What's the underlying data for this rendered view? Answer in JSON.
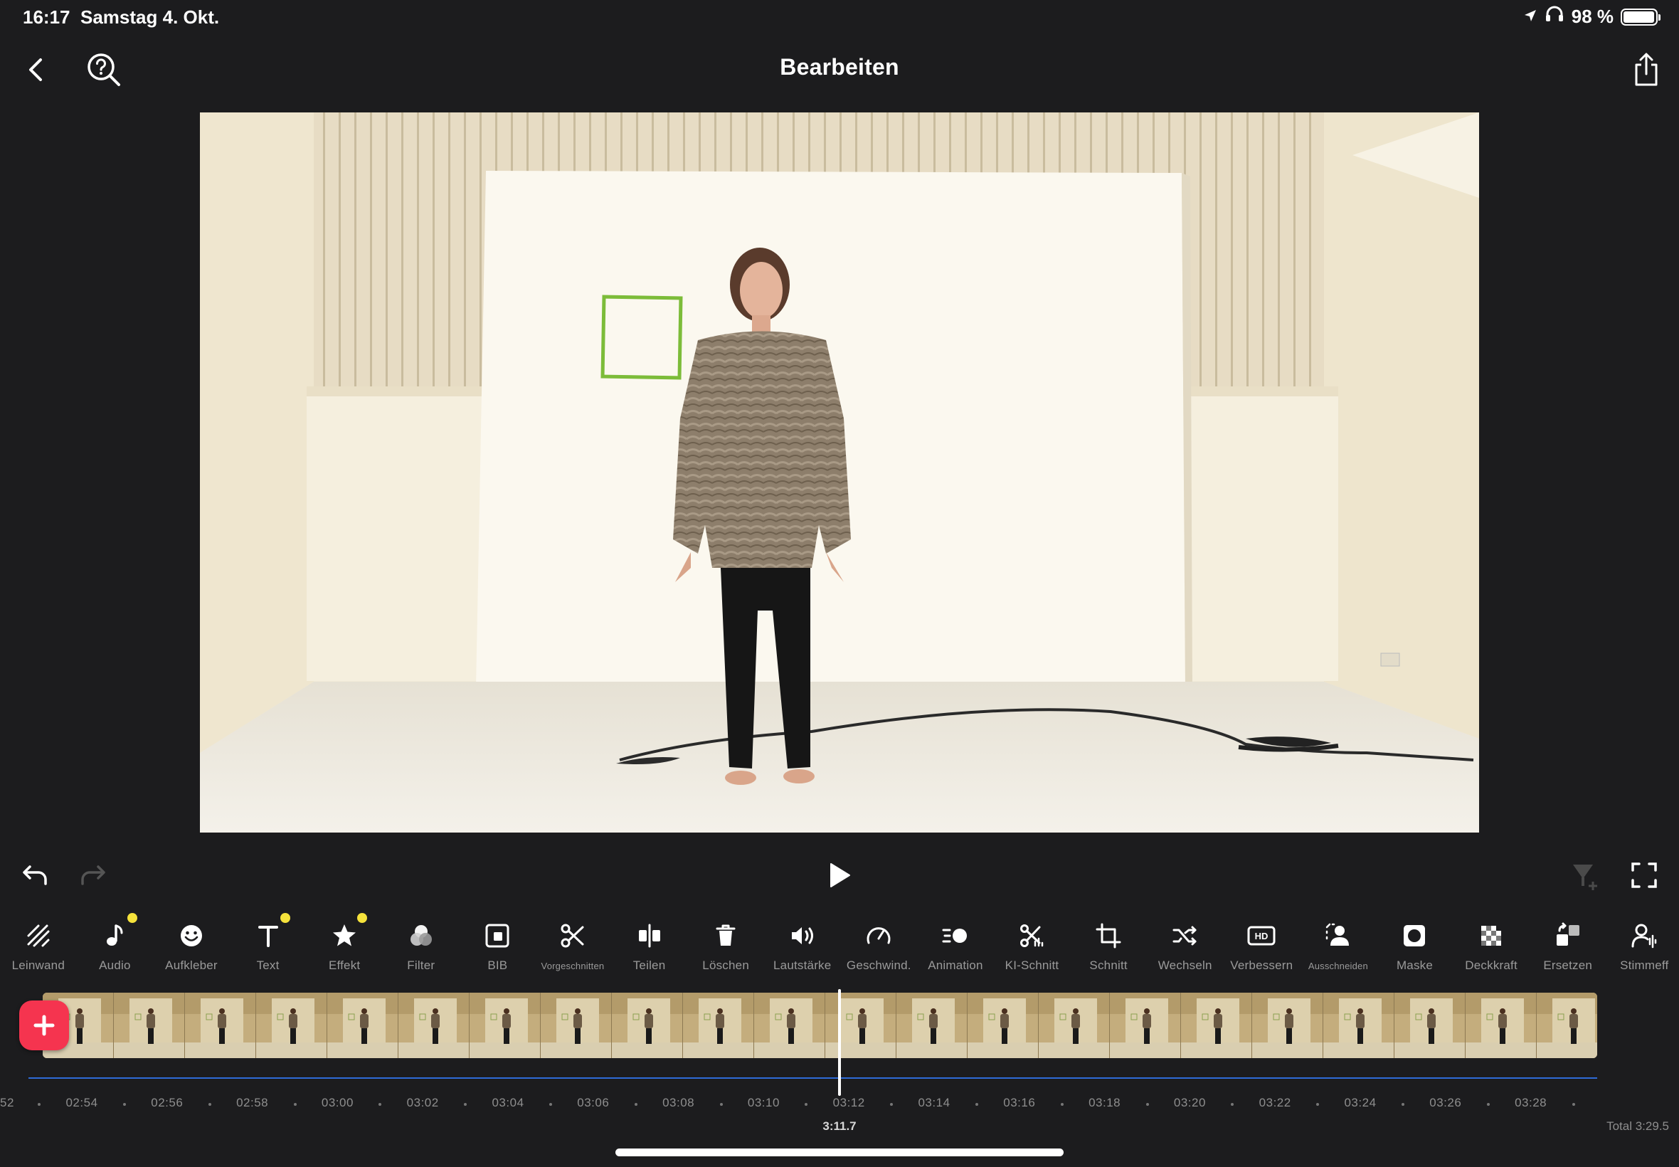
{
  "status_bar": {
    "time": "16:17",
    "date": "Samstag 4. Okt.",
    "battery_text": "98 %",
    "battery_level": 0.98
  },
  "header": {
    "title": "Bearbeiten"
  },
  "toolbar": {
    "items": [
      {
        "label": "Leinwand",
        "icon": "canvas-icon",
        "dot": false
      },
      {
        "label": "Audio",
        "icon": "music-note-icon",
        "dot": true
      },
      {
        "label": "Aufkleber",
        "icon": "smiley-icon",
        "dot": false
      },
      {
        "label": "Text",
        "icon": "text-icon",
        "dot": true
      },
      {
        "label": "Effekt",
        "icon": "star-icon",
        "dot": true
      },
      {
        "label": "Filter",
        "icon": "filter-icon",
        "dot": false
      },
      {
        "label": "BIB",
        "icon": "pip-icon",
        "dot": false
      },
      {
        "label": "Vorgeschnitten",
        "icon": "scissors-icon",
        "dot": false
      },
      {
        "label": "Teilen",
        "icon": "split-icon",
        "dot": false
      },
      {
        "label": "Löschen",
        "icon": "trash-icon",
        "dot": false
      },
      {
        "label": "Lautstärke",
        "icon": "volume-icon",
        "dot": false
      },
      {
        "label": "Geschwind.",
        "icon": "speedometer-icon",
        "dot": false
      },
      {
        "label": "Animation",
        "icon": "animation-icon",
        "dot": false
      },
      {
        "label": "KI-Schnitt",
        "icon": "ai-cut-icon",
        "dot": false
      },
      {
        "label": "Schnitt",
        "icon": "crop-icon",
        "dot": false
      },
      {
        "label": "Wechseln",
        "icon": "shuffle-icon",
        "dot": false
      },
      {
        "label": "Verbessern",
        "icon": "hd-icon",
        "dot": false
      },
      {
        "label": "Ausschneiden",
        "icon": "person-cutout-icon",
        "dot": false
      },
      {
        "label": "Maske",
        "icon": "mask-icon",
        "dot": false
      },
      {
        "label": "Deckkraft",
        "icon": "opacity-icon",
        "dot": false
      },
      {
        "label": "Ersetzen",
        "icon": "replace-icon",
        "dot": false
      },
      {
        "label": "Stimmeff",
        "icon": "voice-effect-icon",
        "dot": false
      }
    ]
  },
  "timeline": {
    "ruler_labels": [
      "52",
      "02:54",
      "02:56",
      "02:58",
      "03:00",
      "03:02",
      "03:04",
      "03:06",
      "03:08",
      "03:10",
      "03:12",
      "03:14",
      "03:16",
      "03:18",
      "03:20",
      "03:22",
      "03:24",
      "03:26",
      "03:28"
    ],
    "current_time": "3:11.7",
    "total": "Total 3:29.5",
    "thumbnail_count": 22
  },
  "colors": {
    "background": "#1c1c1e",
    "add_button": "#f5344f",
    "badge_dot": "#f5e23b",
    "audio_line": "#2f6bd8"
  }
}
